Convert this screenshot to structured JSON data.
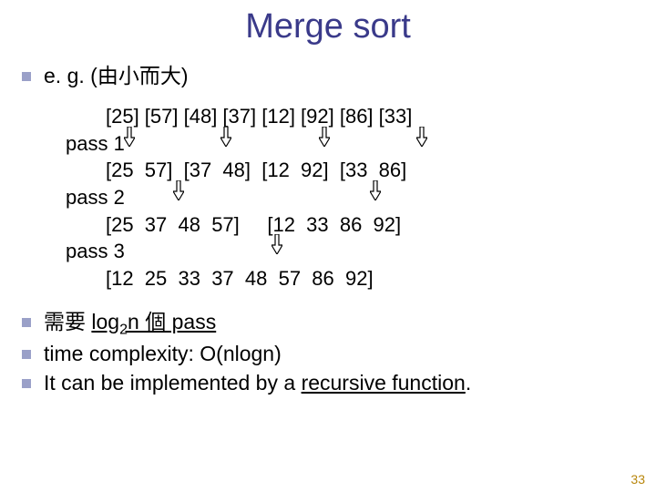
{
  "title": "Merge sort",
  "bullets": {
    "eg": {
      "prefix": "e. g. (",
      "zh": "由小而大",
      "suffix": ")"
    },
    "need": {
      "zh": "需要 ",
      "underlined_pre": "log",
      "sub": "2",
      "underlined_post": "n 個 pass"
    },
    "complexity": "time complexity: O(nlogn)",
    "recursive": {
      "pre": " It can be implemented by a ",
      "underlined": "recursive function",
      "post": "."
    }
  },
  "example": {
    "line0": "[25] [57] [48] [37] [12] [92] [86] [33]",
    "pass1": "pass 1",
    "line1": "[25  57]  [37  48]  [12  92]  [33  86]",
    "pass2": "pass 2",
    "line2": "[25  37  48  57]     [12  33  86  92]",
    "pass3": "pass 3",
    "line3": "[12  25  33  37  48  57  86  92]"
  },
  "chart_data": {
    "type": "table",
    "title": "Merge sort example passes (ascending)",
    "initial": [
      25,
      57,
      48,
      37,
      12,
      92,
      86,
      33
    ],
    "passes": [
      {
        "name": "pass 1",
        "groups": [
          [
            25,
            57
          ],
          [
            37,
            48
          ],
          [
            12,
            92
          ],
          [
            33,
            86
          ]
        ]
      },
      {
        "name": "pass 2",
        "groups": [
          [
            25,
            37,
            48,
            57
          ],
          [
            12,
            33,
            86,
            92
          ]
        ]
      },
      {
        "name": "pass 3",
        "groups": [
          [
            12,
            25,
            33,
            37,
            48,
            57,
            86,
            92
          ]
        ]
      }
    ],
    "pass_count_formula": "log2 n",
    "time_complexity": "O(n log n)"
  },
  "page_number": "33"
}
